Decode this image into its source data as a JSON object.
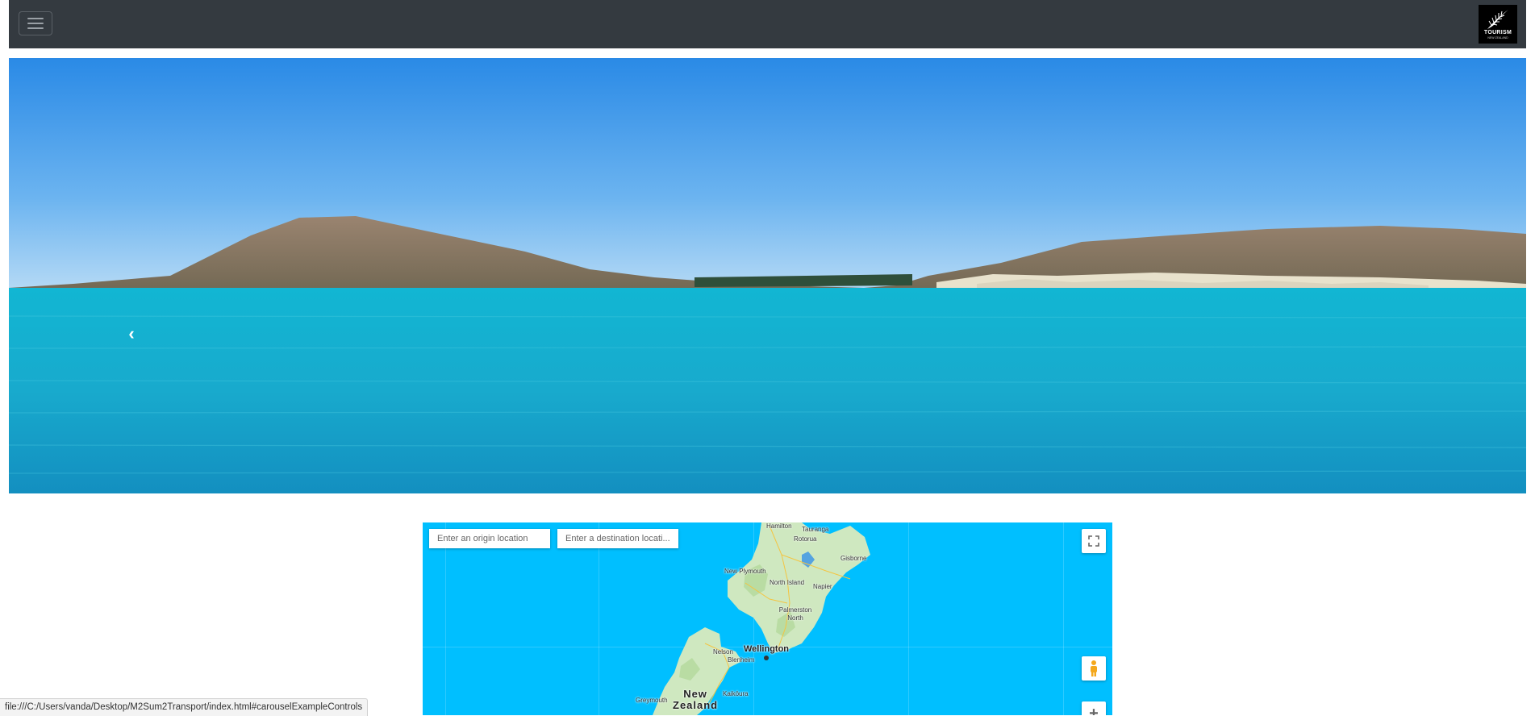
{
  "navbar": {
    "toggler_icon": "hamburger-menu-icon",
    "brand": {
      "logo_icon": "silver-fern-icon",
      "line1": "TOURISM",
      "line2": "NEW ZEALAND"
    }
  },
  "carousel": {
    "prev_icon": "chevron-left-icon",
    "prev_glyph": "‹"
  },
  "map": {
    "origin_placeholder": "Enter an origin location",
    "destination_placeholder": "Enter a destination locati...",
    "fullscreen_icon": "fullscreen-icon",
    "pegman_icon": "pegman-icon",
    "zoom_in_glyph": "+",
    "labels": {
      "hamilton": "Hamilton",
      "tauranga": "Tauranga",
      "rotorua": "Rotorua",
      "gisborne": "Gisborne",
      "new_plymouth": "New Plymouth",
      "north_island": "North Island",
      "napier": "Napier",
      "palmerston_north": "Palmerston North",
      "nelson": "Nelson",
      "wellington": "Wellington",
      "blenheim": "Blenheim",
      "kaikoura": "Kaikōura",
      "greymouth": "Greymouth",
      "new_zealand_1": "New",
      "new_zealand_2": "Zealand"
    },
    "colors": {
      "water": "#00bfff",
      "land": "#cfe8c0"
    }
  },
  "statusbar": {
    "url": "file:///C:/Users/vanda/Desktop/M2Sum2Transport/index.html#carouselExampleControls"
  }
}
